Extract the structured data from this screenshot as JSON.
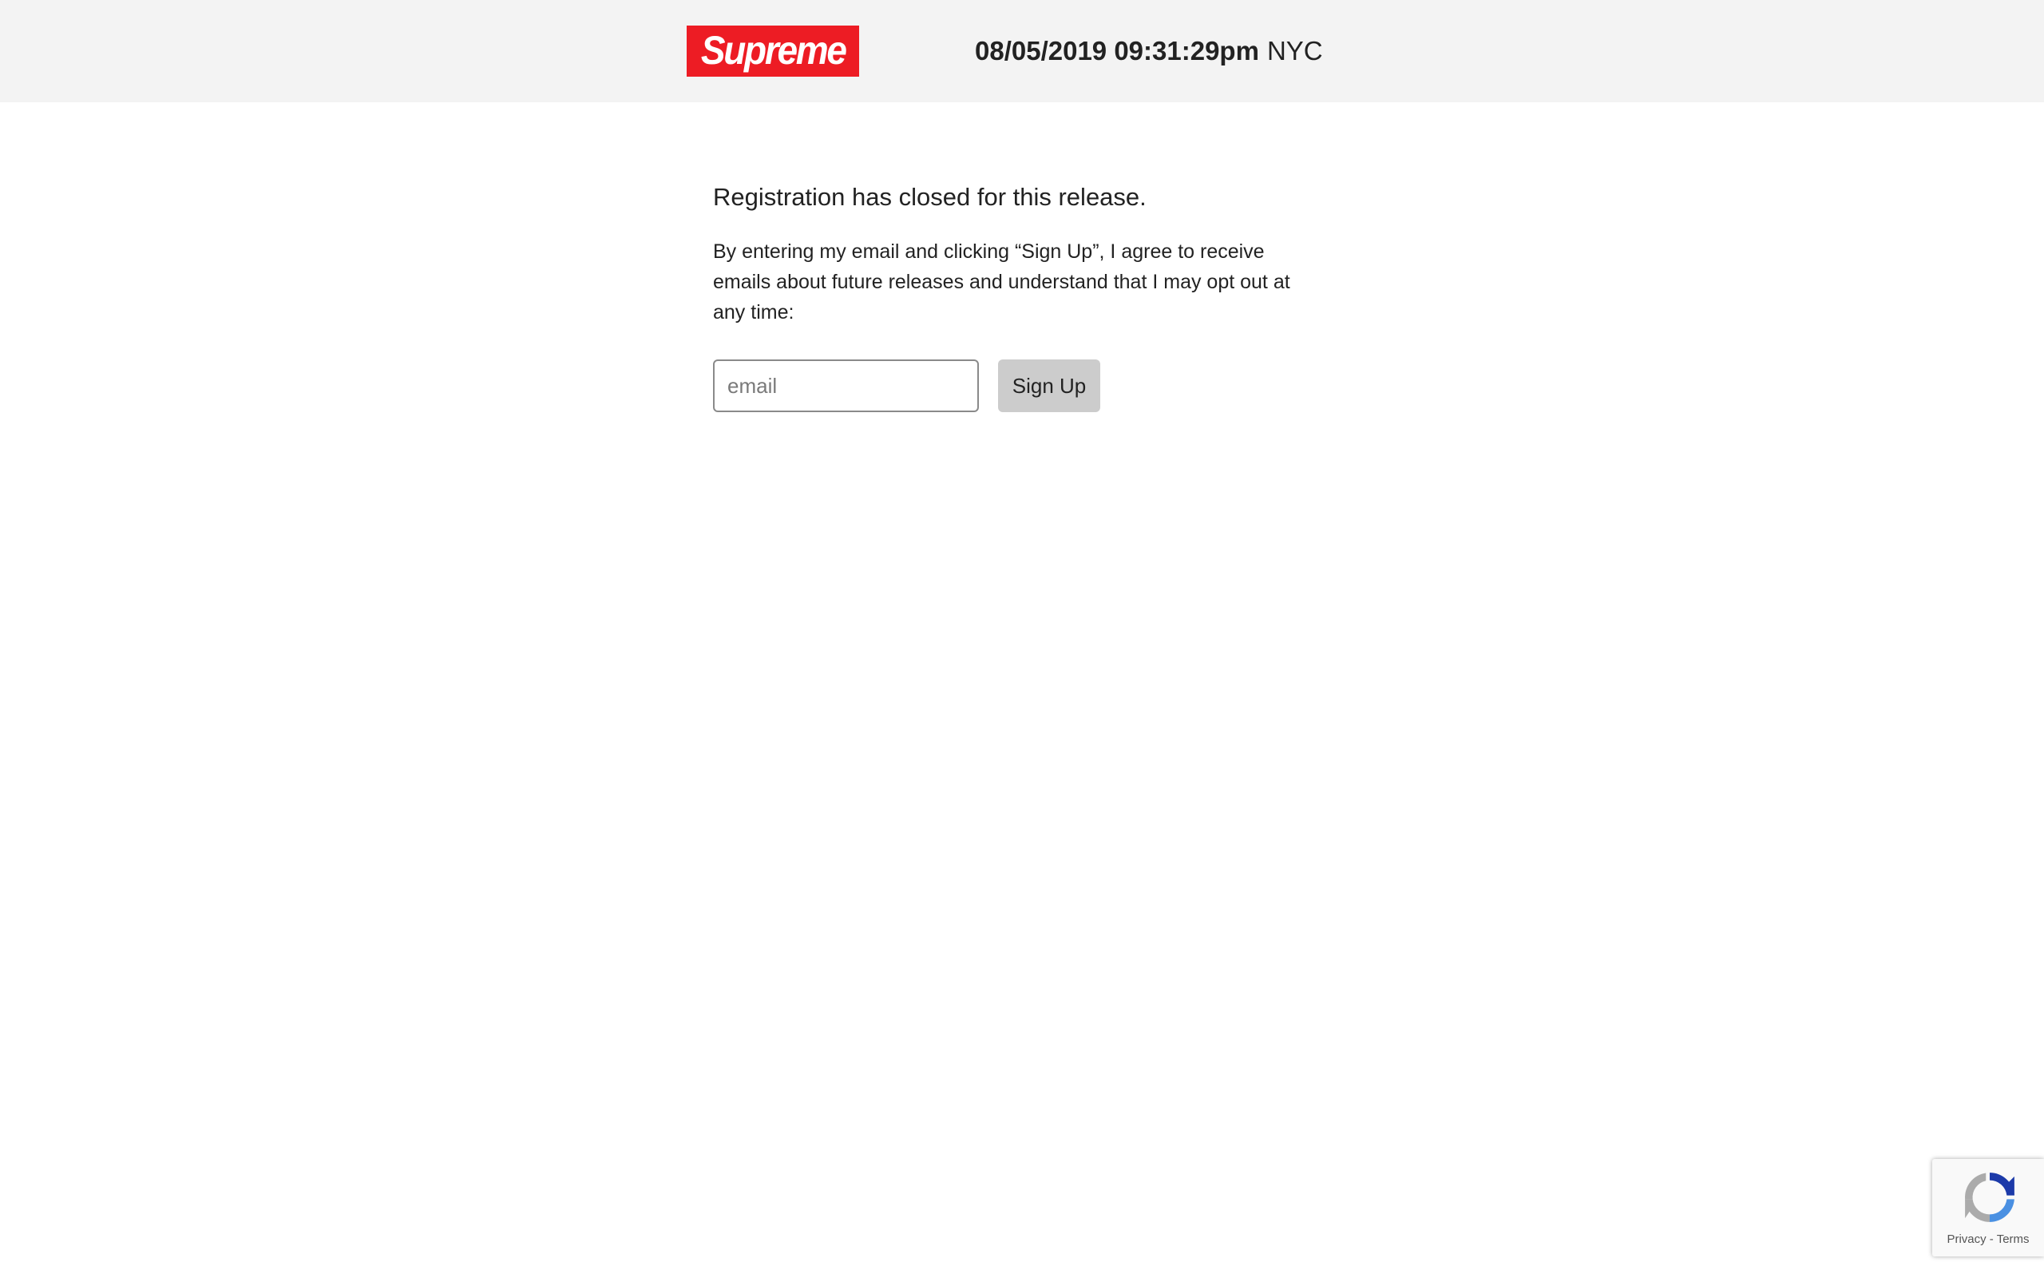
{
  "header": {
    "logo_text": "Supreme",
    "brand_color": "#ed1c24",
    "datetime": "08/05/2019 09:31:29pm",
    "city": "NYC"
  },
  "main": {
    "closed_message": "Registration has closed for this release.",
    "consent_text": "By entering my email and clicking “Sign Up”, I agree to receive emails about future releases and understand that I may opt out at any time:",
    "email_placeholder": "email",
    "email_value": "",
    "signup_label": "Sign Up"
  },
  "recaptcha": {
    "icon": "recaptcha-icon",
    "privacy_label": "Privacy",
    "separator": " - ",
    "terms_label": "Terms"
  }
}
